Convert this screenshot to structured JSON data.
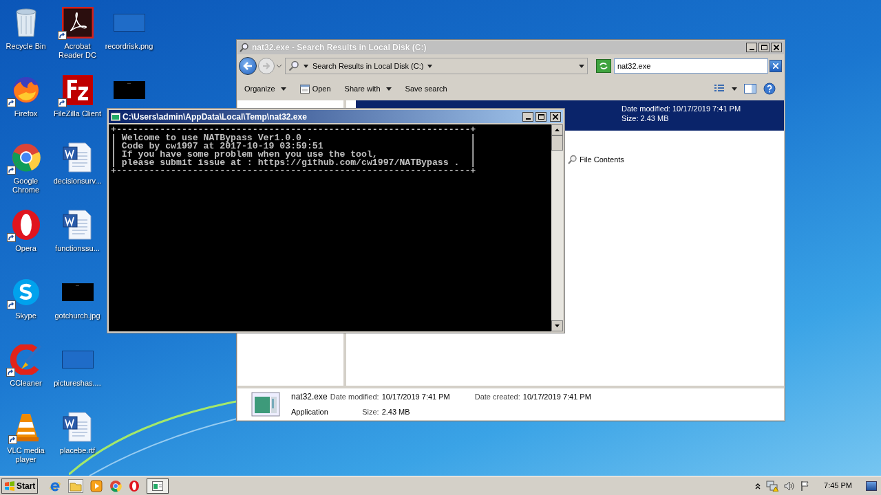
{
  "desktop_icons": [
    {
      "kind": "recycle",
      "label": "Recycle Bin",
      "shortcut": false
    },
    {
      "kind": "firefox",
      "label": "Firefox",
      "shortcut": true
    },
    {
      "kind": "chrome",
      "label": "Google Chrome",
      "shortcut": true
    },
    {
      "kind": "opera",
      "label": "Opera",
      "shortcut": true
    },
    {
      "kind": "skype",
      "label": "Skype",
      "shortcut": true
    },
    {
      "kind": "ccleaner",
      "label": "CCleaner",
      "shortcut": true
    },
    {
      "kind": "vlc",
      "label": "VLC media player",
      "shortcut": true
    },
    {
      "kind": "acrobat",
      "label": "Acrobat Reader DC",
      "shortcut": true
    },
    {
      "kind": "filezilla",
      "label": "FileZilla Client",
      "shortcut": true
    },
    {
      "kind": "word",
      "label": "decisionsurv...",
      "shortcut": false
    },
    {
      "kind": "word",
      "label": "functionssu...",
      "shortcut": false
    },
    {
      "kind": "thumb_dark",
      "label": "gotchurch.jpg",
      "shortcut": false
    },
    {
      "kind": "thumb_light",
      "label": "pictureshas....",
      "shortcut": false
    },
    {
      "kind": "word",
      "label": "placebe.rtf",
      "shortcut": false
    },
    {
      "kind": "thumb_light",
      "label": "recordrisk.png",
      "shortcut": false
    },
    {
      "kind": "thumb_dark",
      "shortcut": false
    }
  ],
  "explorer": {
    "title": "nat32.exe - Search Results in Local Disk (C:)",
    "address": "Search Results in Local Disk (C:)",
    "search_value": "nat32.exe",
    "toolbar": [
      {
        "kind": "menu",
        "label": "Organize"
      },
      {
        "kind": "open",
        "label": "Open"
      },
      {
        "kind": "menu",
        "label": "Share with"
      },
      {
        "kind": "plain",
        "label": "Save search"
      }
    ],
    "result": {
      "selected": true,
      "date_modified": "Date modified: 10/17/2019 7:41 PM",
      "size": "Size: 2.43 MB"
    },
    "file_contents": "File Contents",
    "details": {
      "name": "nat32.exe",
      "type": "Application",
      "date_modified_label": "Date modified:",
      "date_modified": "10/17/2019 7:41 PM",
      "date_created_label": "Date created:",
      "date_created": "10/17/2019 7:41 PM",
      "size_label": "Size:",
      "size": "2.43 MB"
    }
  },
  "console": {
    "title": "C:\\Users\\admin\\AppData\\Local\\Temp\\nat32.exe",
    "lines": [
      "+-----------------------------------------------------------------+",
      "| Welcome to use NATBypass Ver1.0.0 .                             |",
      "| Code by cw1997 at 2017-10-19 03:59:51                           |",
      "| If you have some problem when you use the tool,                 |",
      "| please submit issue at : https://github.com/cw1997/NATBypass .  |",
      "+-----------------------------------------------------------------+"
    ]
  },
  "taskbar": {
    "start": "Start",
    "pinned": [
      {
        "kind": "ie"
      },
      {
        "kind": "explorer"
      },
      {
        "kind": "media"
      },
      {
        "kind": "chrome"
      },
      {
        "kind": "opera"
      },
      {
        "kind": "console",
        "selected": true
      }
    ],
    "clock": "7:45 PM"
  }
}
